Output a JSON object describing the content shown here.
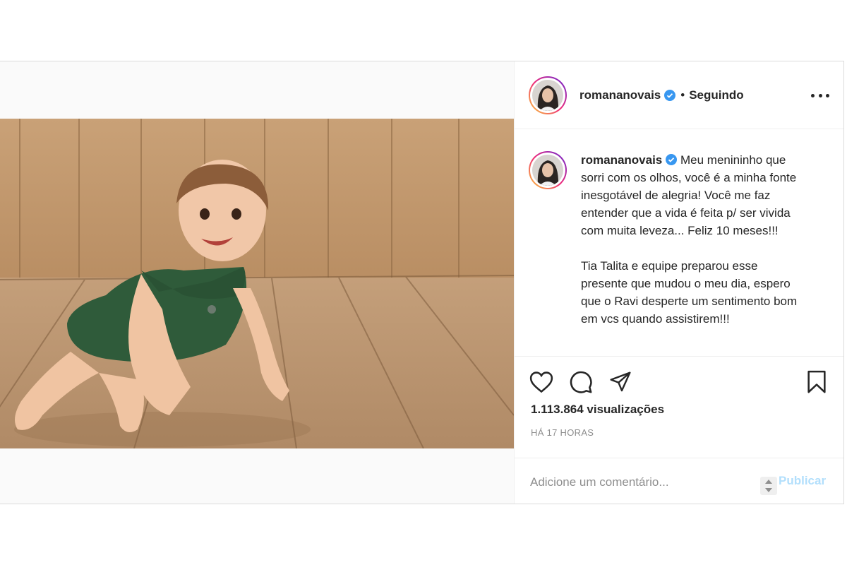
{
  "post": {
    "username": "romananovais",
    "follow_separator": "•",
    "follow_status": "Seguindo",
    "caption_paragraphs": [
      "Meu menininho que sorri com os olhos, você é a minha fonte inesgotável de alegria! Você me faz entender que a vida é feita p/ ser vivida com muita leveza... Feliz 10 meses!!!",
      "Tia Talita e equipe preparou esse presente que mudou o meu dia, espero que o Ravi desperte um sentimento bom em vcs quando assistirem!!!"
    ],
    "views": "1.113.864 visualizações",
    "time_ago": "HÁ 17 HORAS"
  },
  "comment": {
    "placeholder": "Adicione um comentário...",
    "publish_label": "Publicar"
  },
  "icons": {
    "like": "heart-icon",
    "comment": "comment-icon",
    "share": "share-icon",
    "save": "bookmark-icon",
    "more": "more-options-icon",
    "mute": "mute-icon",
    "verified": "verified-badge-icon"
  },
  "colors": {
    "verified": "#3897f0",
    "publish_disabled": "#b2dffc",
    "muted_text": "#8e8e8e",
    "text": "#262626"
  }
}
